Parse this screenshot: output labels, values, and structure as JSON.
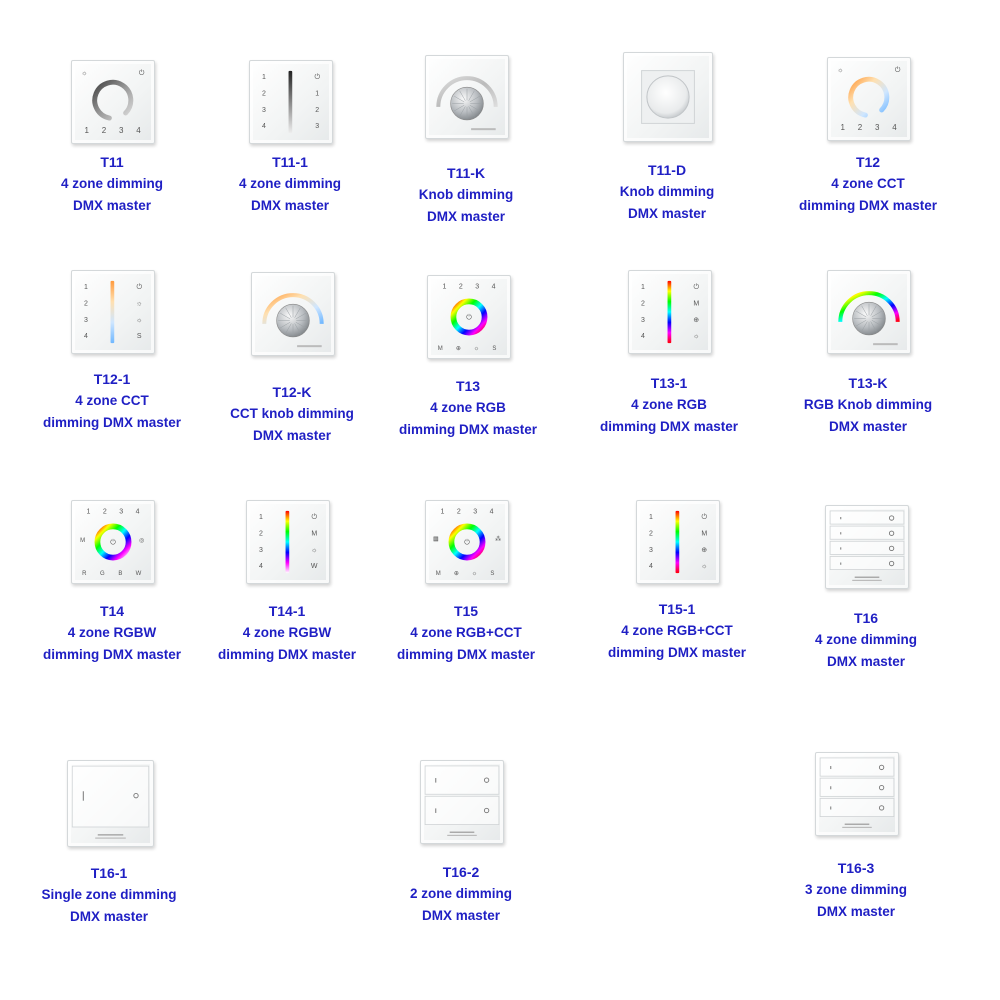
{
  "products": [
    {
      "model": "T11",
      "lines": [
        "4 zone dimming",
        "DMX master"
      ],
      "style": "ring-white"
    },
    {
      "model": "T11-1",
      "lines": [
        "4 zone dimming",
        "DMX master"
      ],
      "style": "bar-white"
    },
    {
      "model": "T11-K",
      "lines": [
        "Knob dimming",
        "DMX master"
      ],
      "style": "knob-white"
    },
    {
      "model": "T11-D",
      "lines": [
        "Knob dimming",
        "DMX master"
      ],
      "style": "dial"
    },
    {
      "model": "T12",
      "lines": [
        "4 zone CCT",
        "dimming DMX master"
      ],
      "style": "ring-cct"
    },
    {
      "model": "T12-1",
      "lines": [
        "4 zone CCT",
        "dimming DMX master"
      ],
      "style": "bar-cct"
    },
    {
      "model": "T12-K",
      "lines": [
        "CCT knob dimming",
        "DMX master"
      ],
      "style": "knob-cct"
    },
    {
      "model": "T13",
      "lines": [
        "4 zone RGB",
        "dimming DMX master"
      ],
      "style": "ring-rgb"
    },
    {
      "model": "T13-1",
      "lines": [
        "4 zone RGB",
        "dimming DMX master"
      ],
      "style": "bar-rgb"
    },
    {
      "model": "T13-K",
      "lines": [
        "RGB Knob dimming",
        "DMX master"
      ],
      "style": "knob-rgb"
    },
    {
      "model": "T14",
      "lines": [
        "4 zone RGBW",
        "dimming DMX master"
      ],
      "style": "ring-rgbw"
    },
    {
      "model": "T14-1",
      "lines": [
        "4 zone RGBW",
        "dimming DMX master"
      ],
      "style": "bar-rgbw"
    },
    {
      "model": "T15",
      "lines": [
        "4 zone RGB+CCT",
        "dimming DMX master"
      ],
      "style": "ring-rgbcct"
    },
    {
      "model": "T15-1",
      "lines": [
        "4 zone RGB+CCT",
        "dimming DMX master"
      ],
      "style": "bar-rgbcct"
    },
    {
      "model": "T16",
      "lines": [
        "4 zone dimming",
        "DMX master"
      ],
      "style": "keys-4"
    },
    {
      "model": "T16-1",
      "lines": [
        "Single zone dimming",
        "DMX master"
      ],
      "style": "keys-1"
    },
    {
      "model": "T16-2",
      "lines": [
        "2 zone dimming",
        "DMX master"
      ],
      "style": "keys-2"
    },
    {
      "model": "T16-3",
      "lines": [
        "3 zone dimming",
        "DMX master"
      ],
      "style": "keys-3"
    }
  ],
  "colors": {
    "caption": "#1f1fc4"
  }
}
